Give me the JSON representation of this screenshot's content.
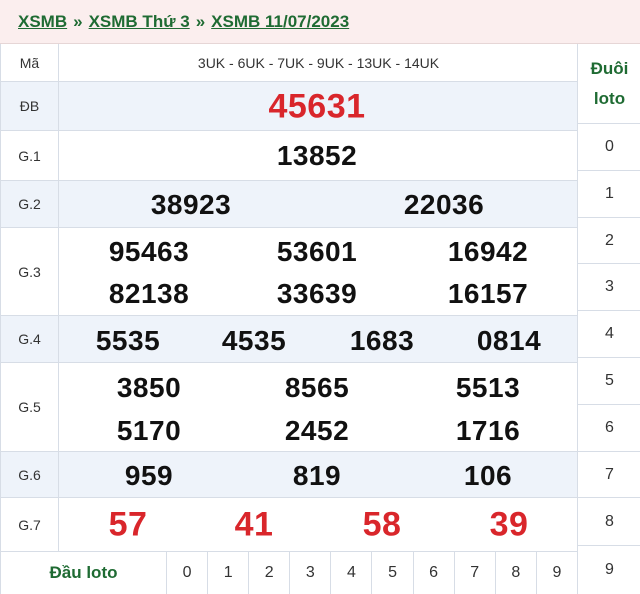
{
  "breadcrumb": {
    "item1": "XSMB",
    "item2": "XSMB Thứ 3",
    "item3": "XSMB 11/07/2023",
    "separator": "»"
  },
  "ma": {
    "label": "Mã",
    "value": "3UK - 6UK - 7UK - 9UK - 13UK - 14UK"
  },
  "prizes": {
    "db": {
      "label": "ĐB",
      "numbers": [
        "45631"
      ]
    },
    "g1": {
      "label": "G.1",
      "numbers": [
        "13852"
      ]
    },
    "g2": {
      "label": "G.2",
      "numbers": [
        "38923",
        "22036"
      ]
    },
    "g3": {
      "label": "G.3",
      "numbers": [
        "95463",
        "53601",
        "16942",
        "82138",
        "33639",
        "16157"
      ]
    },
    "g4": {
      "label": "G.4",
      "numbers": [
        "5535",
        "4535",
        "1683",
        "0814"
      ]
    },
    "g5": {
      "label": "G.5",
      "numbers": [
        "3850",
        "8565",
        "5513",
        "5170",
        "2452",
        "1716"
      ]
    },
    "g6": {
      "label": "G.6",
      "numbers": [
        "959",
        "819",
        "106"
      ]
    },
    "g7": {
      "label": "G.7",
      "numbers": [
        "57",
        "41",
        "58",
        "39"
      ]
    }
  },
  "dau_loto": {
    "title": "Đầu loto",
    "digits": [
      "0",
      "1",
      "2",
      "3",
      "4",
      "5",
      "6",
      "7",
      "8",
      "9"
    ]
  },
  "duoi_loto": {
    "title_line1": "Đuôi",
    "title_line2": "loto",
    "digits": [
      "0",
      "1",
      "2",
      "3",
      "4",
      "5",
      "6",
      "7",
      "8",
      "9"
    ]
  },
  "colors": {
    "accent_green": "#1f6b33",
    "prize_red": "#d9262b",
    "row_shade": "#eef3fa"
  }
}
